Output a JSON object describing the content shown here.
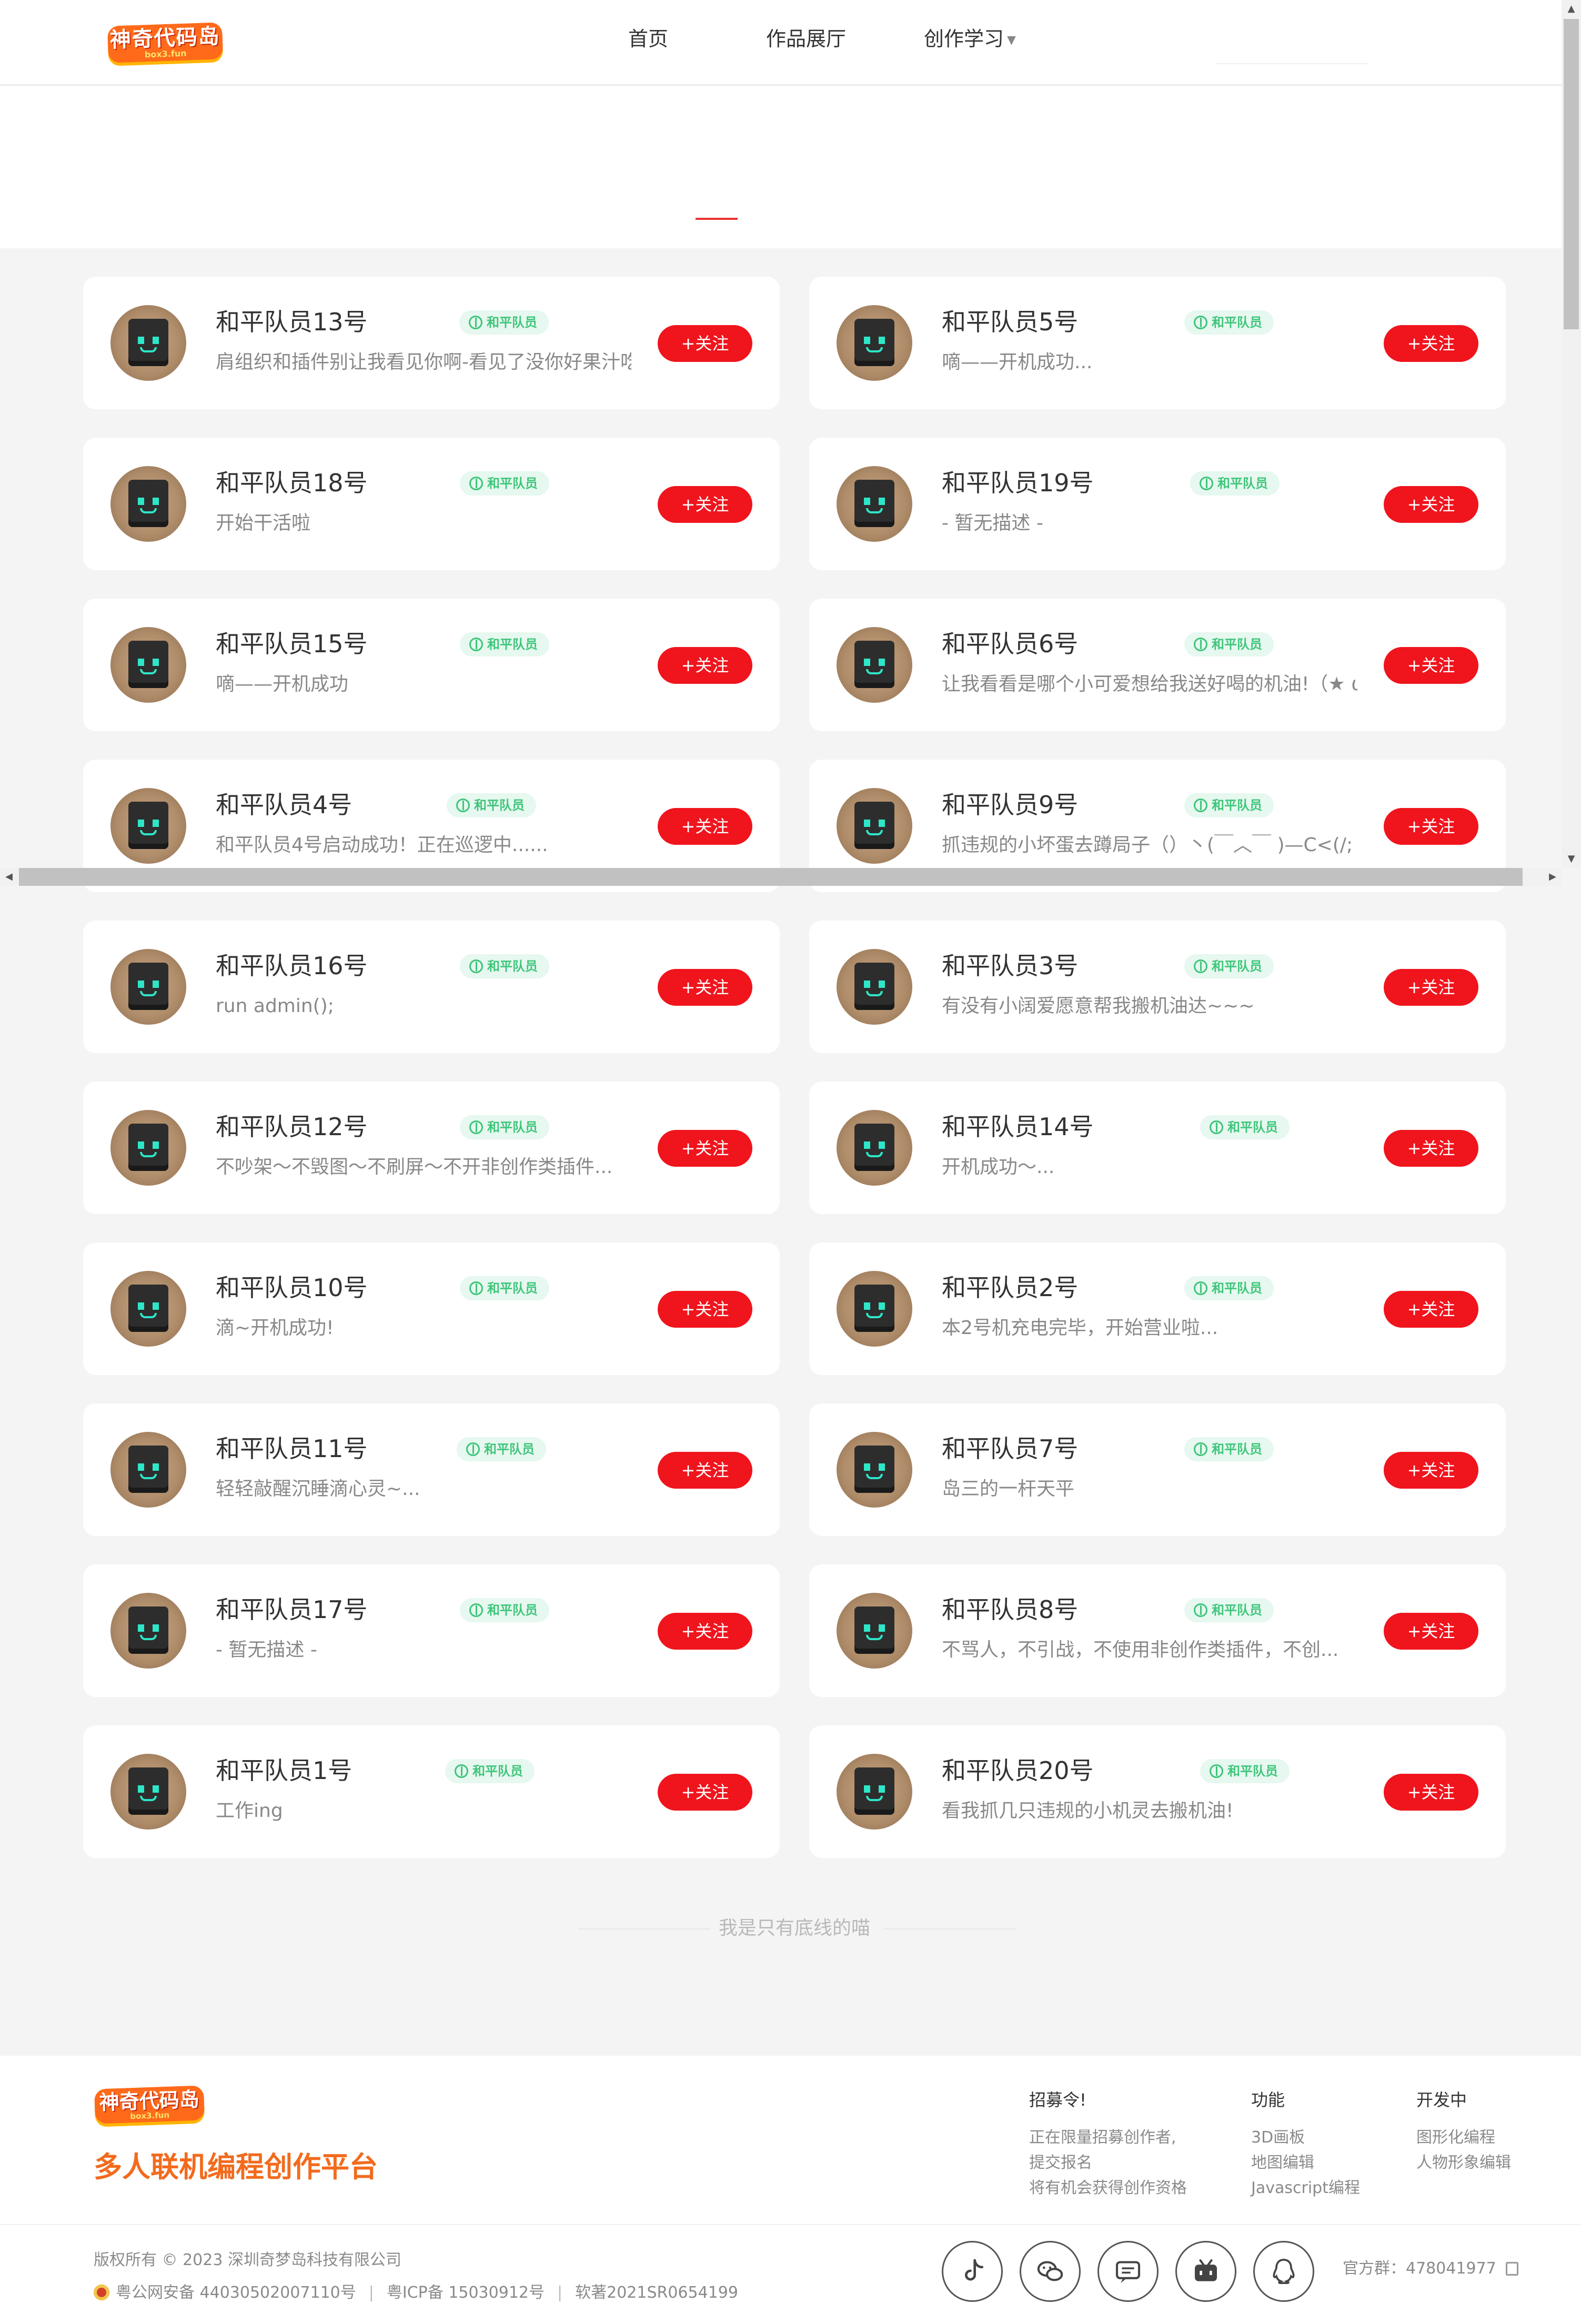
{
  "header": {
    "logo_text": "神奇代码岛",
    "logo_sub": "box3.fun",
    "nav": [
      {
        "label": "首页"
      },
      {
        "label": "作品展厅"
      },
      {
        "label": "创作学习",
        "has_dropdown": true
      }
    ]
  },
  "users": [
    {
      "name": "和平队员13号",
      "tag": "和平队员",
      "desc": "肩组织和插件别让我看见你啊-看见了没你好果汁吃",
      "follow": "+关注"
    },
    {
      "name": "和平队员5号",
      "tag": "和平队员",
      "desc": "嘀——开机成功...",
      "follow": "+关注"
    },
    {
      "name": "和平队员18号",
      "tag": "和平队员",
      "desc": "开始干活啦",
      "follow": "+关注"
    },
    {
      "name": "和平队员19号",
      "tag": "和平队员",
      "desc": "- 暂无描述 -",
      "follow": "+关注"
    },
    {
      "name": "和平队员15号",
      "tag": "和平队员",
      "desc": "嘀——开机成功",
      "follow": "+关注"
    },
    {
      "name": "和平队员6号",
      "tag": "和平队员",
      "desc": "让我看看是哪个小可爱想给我送好喝的机油!（★ ω ★）",
      "follow": "+关注"
    },
    {
      "name": "和平队员4号",
      "tag": "和平队员",
      "desc": "和平队员4号启动成功！正在巡逻中......",
      "follow": "+关注"
    },
    {
      "name": "和平队员9号",
      "tag": "和平队员",
      "desc": "抓违规的小坏蛋去蹲局子（）丶(￣︿￣ )—C<(/;",
      "follow": "+关注"
    },
    {
      "name": "和平队员16号",
      "tag": "和平队员",
      "desc": "run admin();",
      "follow": "+关注"
    },
    {
      "name": "和平队员3号",
      "tag": "和平队员",
      "desc": "有没有小阔爱愿意帮我搬机油达~~~",
      "follow": "+关注"
    },
    {
      "name": "和平队员12号",
      "tag": "和平队员",
      "desc": "不吵架～不毁图～不刷屏～不开非创作类插件...",
      "follow": "+关注"
    },
    {
      "name": "和平队员14号",
      "tag": "和平队员",
      "desc": "开机成功～...",
      "follow": "+关注"
    },
    {
      "name": "和平队员10号",
      "tag": "和平队员",
      "desc": "滴~开机成功!",
      "follow": "+关注"
    },
    {
      "name": "和平队员2号",
      "tag": "和平队员",
      "desc": "本2号机充电完毕，开始营业啦...",
      "follow": "+关注"
    },
    {
      "name": "和平队员11号",
      "tag": "和平队员",
      "desc": "轻轻敲醒沉睡滴心灵~...",
      "follow": "+关注"
    },
    {
      "name": "和平队员7号",
      "tag": "和平队员",
      "desc": "岛三的一杆天平",
      "follow": "+关注"
    },
    {
      "name": "和平队员17号",
      "tag": "和平队员",
      "desc": "- 暂无描述 -",
      "follow": "+关注"
    },
    {
      "name": "和平队员8号",
      "tag": "和平队员",
      "desc": "不骂人，不引战，不使用非创作类插件，不创...",
      "follow": "+关注"
    },
    {
      "name": "和平队员1号",
      "tag": "和平队员",
      "desc": "工作ing",
      "follow": "+关注"
    },
    {
      "name": "和平队员20号",
      "tag": "和平队员",
      "desc": "看我抓几只违规的小机灵去搬机油!",
      "follow": "+关注"
    }
  ],
  "end_text": "我是只有底线的喵",
  "footer": {
    "logo_text": "神奇代码岛",
    "logo_sub": "box3.fun",
    "slogan": "多人联机编程创作平台",
    "columns": [
      {
        "title": "招募令!",
        "lines": [
          "正在限量招募创作者,",
          "提交报名",
          "将有机会获得创作资格"
        ]
      },
      {
        "title": "功能",
        "lines": [
          "3D画板",
          "地图编辑",
          "Javascript编程"
        ]
      },
      {
        "title": "开发中",
        "lines": [
          "图形化编程",
          "人物形象编辑"
        ]
      }
    ],
    "copyright": "版权所有 © 2023 深圳奇梦岛科技有限公司",
    "beian": [
      "粤公网安备 44030502007110号",
      "粤ICP备 15030912号",
      "软著2021SR0654199"
    ],
    "social_icons": [
      "douyin-icon",
      "wechat-icon",
      "chat-bubble-icon",
      "bilibili-icon",
      "qq-icon"
    ],
    "qq_group": "官方群：478041977"
  },
  "colors": {
    "accent_red": "#f0141d",
    "tag_green": "#3ec57a",
    "slogan_orange": "#f26b1d"
  }
}
